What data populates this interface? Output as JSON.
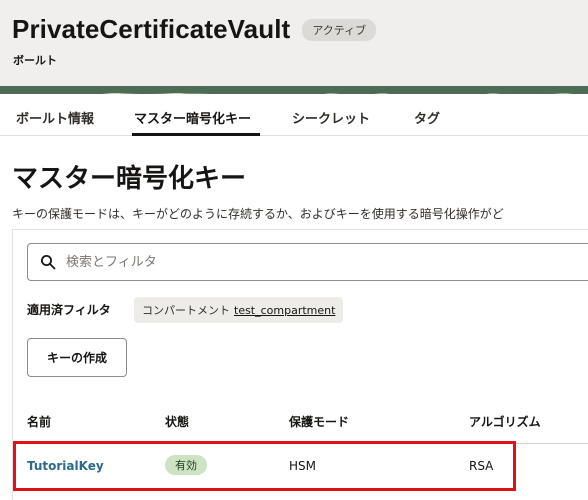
{
  "header": {
    "vault_name": "PrivateCertificateVault",
    "status": "アクティブ",
    "subtitle": "ボールト"
  },
  "tabs": [
    {
      "label": "ボールト情報",
      "active": false
    },
    {
      "label": "マスター暗号化キー",
      "active": true
    },
    {
      "label": "シークレット",
      "active": false
    },
    {
      "label": "タグ",
      "active": false
    }
  ],
  "main": {
    "title": "マスター暗号化キー",
    "description": "キーの保護モードは、キーがどのように存続するか、およびキーを使用する暗号化操作がど"
  },
  "search": {
    "placeholder": "検索とフィルタ",
    "value": ""
  },
  "filters": {
    "label": "適用済フィルタ",
    "chip_label": "コンパートメント",
    "chip_value": "test_compartment"
  },
  "actions": {
    "create_key": "キーの作成"
  },
  "table": {
    "columns": [
      "名前",
      "状態",
      "保護モード",
      "アルゴリズム"
    ],
    "rows": [
      {
        "name": "TutorialKey",
        "state": "有効",
        "protection_mode": "HSM",
        "algorithm": "RSA"
      }
    ]
  },
  "colors": {
    "link": "#2a6a8c",
    "active_badge": "#cde3c4",
    "highlight": "#e0111b",
    "banner": "#4d6b55"
  }
}
